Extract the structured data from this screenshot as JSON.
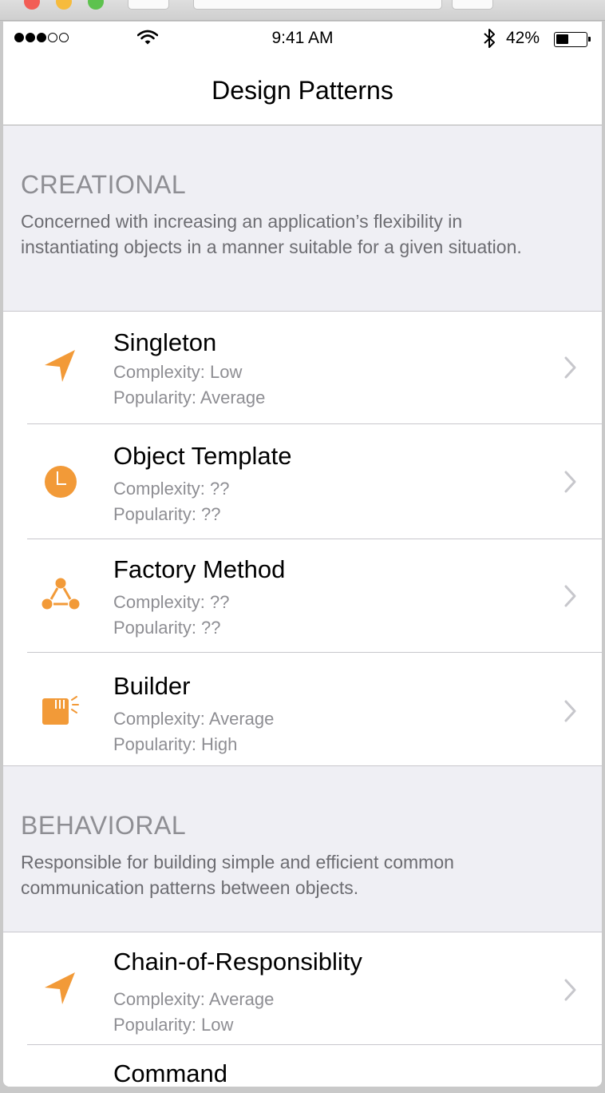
{
  "status_bar": {
    "time": "9:41 AM",
    "battery_percent": "42%",
    "battery_level": 0.42,
    "signal_bars_filled": 3,
    "signal_bars_total": 5
  },
  "nav": {
    "title": "Design Patterns"
  },
  "sections": [
    {
      "title": "CREATIONAL",
      "description": "Concerned with increasing an application’s flexibility in instantiating objects in a manner suitable for a given situation.",
      "items": [
        {
          "name": "Singleton",
          "complexity": "Complexity: Low",
          "popularity": "Popularity: Average",
          "icon": "location-arrow-icon"
        },
        {
          "name": "Object Template",
          "complexity": "Complexity: ??",
          "popularity": "Popularity: ??",
          "icon": "clock-icon"
        },
        {
          "name": "Factory Method",
          "complexity": "Complexity: ??",
          "popularity": "Popularity: ??",
          "icon": "network-triangle-icon"
        },
        {
          "name": "Builder",
          "complexity": "Complexity: Average",
          "popularity": "Popularity: High",
          "icon": "builder-box-icon"
        }
      ]
    },
    {
      "title": "BEHAVIORAL",
      "description": "Responsible for building simple and efficient common communication patterns between objects.",
      "items": [
        {
          "name": "Chain-of-Responsiblity",
          "complexity": "Complexity: Average",
          "popularity": "Popularity: Low",
          "icon": "location-arrow-icon"
        },
        {
          "name": "Command",
          "complexity": "",
          "popularity": "",
          "icon": "clock-icon"
        }
      ]
    }
  ],
  "colors": {
    "accent": "#f29a38",
    "section_background": "#efeff4",
    "secondary_text": "#8e8e93",
    "separator": "#c8c7cc"
  }
}
